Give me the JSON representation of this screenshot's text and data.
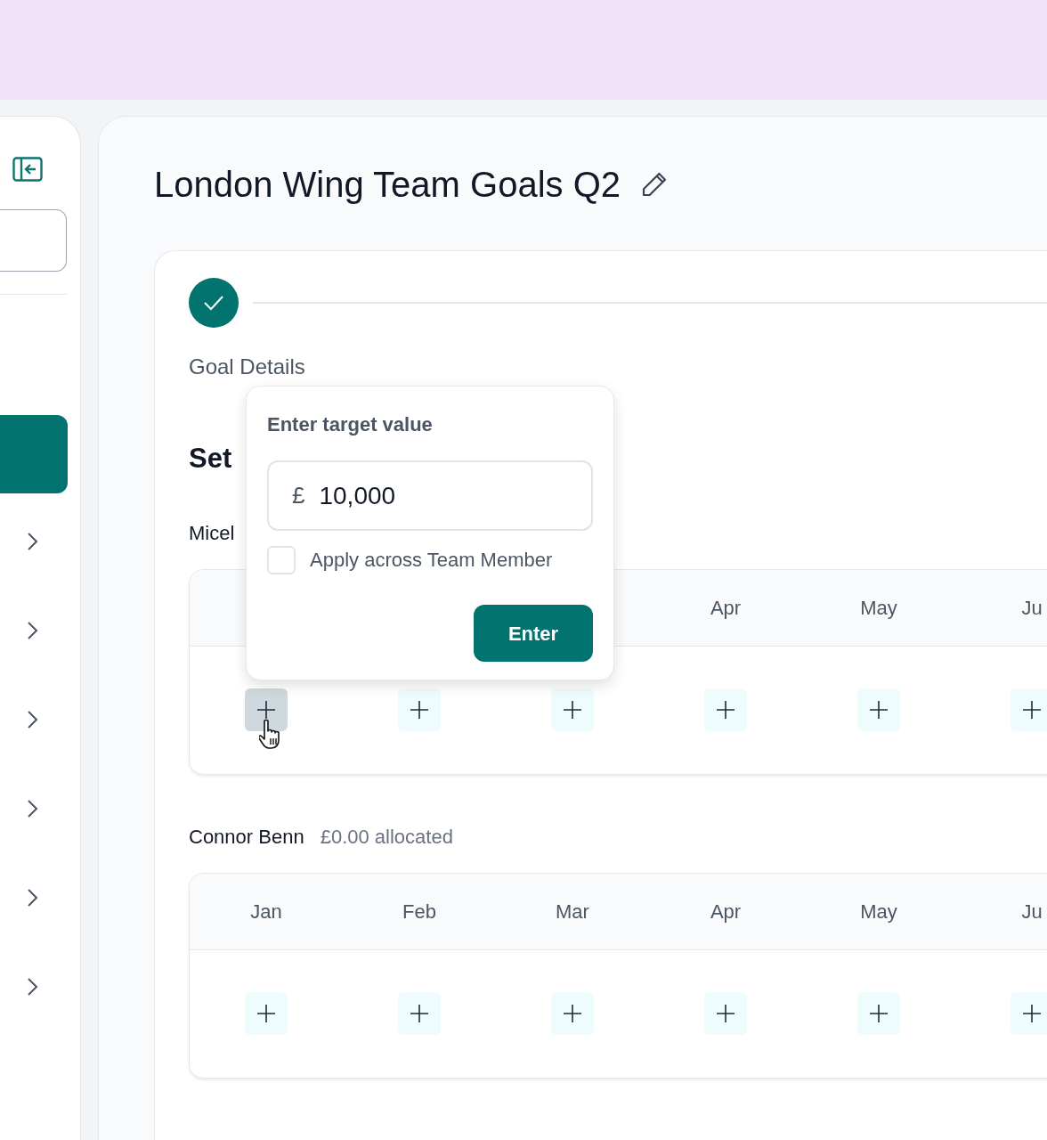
{
  "sidebar": {
    "items": [
      {
        "selected": true
      },
      {
        "selected": false
      },
      {
        "selected": false
      },
      {
        "selected": false
      },
      {
        "selected": false
      },
      {
        "selected": false
      },
      {
        "selected": false
      }
    ]
  },
  "page": {
    "title": "London Wing Team Goals Q2"
  },
  "stepper": {
    "steps": [
      {
        "label": "Goal Details",
        "completed": true
      }
    ]
  },
  "section": {
    "title": "Set"
  },
  "members": [
    {
      "name": "Micel",
      "months": [
        "Apr",
        "May",
        "Ju"
      ],
      "cells": [
        {
          "hovered": true
        },
        {
          "hovered": false
        },
        {
          "hovered": false
        },
        {
          "hovered": false
        },
        {
          "hovered": false
        },
        {
          "hovered": false
        }
      ]
    },
    {
      "name": "Connor Benn",
      "allocated": "£0.00 allocated",
      "months": [
        "Jan",
        "Feb",
        "Mar",
        "Apr",
        "May",
        "Ju"
      ],
      "cells": [
        {
          "hovered": false
        },
        {
          "hovered": false
        },
        {
          "hovered": false
        },
        {
          "hovered": false
        },
        {
          "hovered": false
        },
        {
          "hovered": false
        }
      ]
    }
  ],
  "popover": {
    "title": "Enter target value",
    "currency": "£",
    "value": "10,000",
    "checkbox": {
      "label": "Apply across Team Member",
      "checked": false
    },
    "button": "Enter"
  }
}
